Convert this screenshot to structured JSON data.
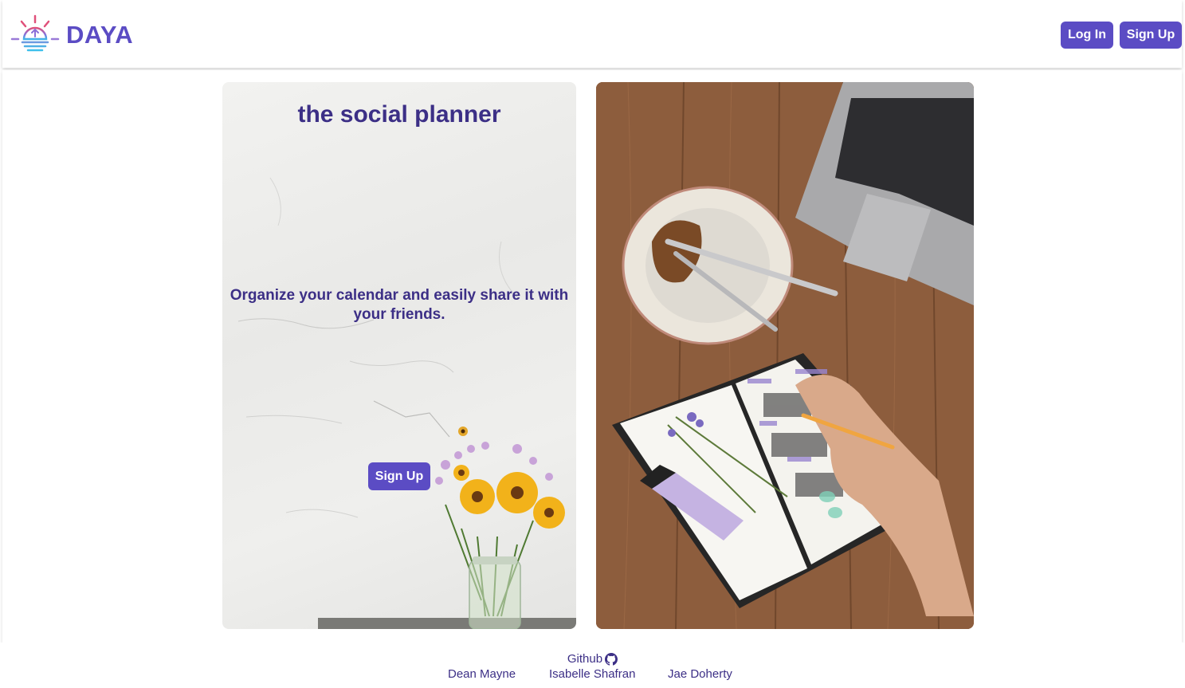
{
  "header": {
    "brand_name": "DAYA",
    "login_label": "Log In",
    "signup_label": "Sign Up"
  },
  "hero": {
    "tagline": "the social planner",
    "subtitle": "Organize your calendar and easily share it with your friends.",
    "signup_label": "Sign Up"
  },
  "footer": {
    "github_label": "Github",
    "authors": [
      "Dean Mayne",
      "Isabelle Shafran",
      "Jae Doherty"
    ]
  },
  "colors": {
    "accent": "#5b4cc4",
    "text_dark": "#3c2f86"
  },
  "icons": {
    "logo": "sunrise-logo-icon",
    "github": "github-icon"
  }
}
